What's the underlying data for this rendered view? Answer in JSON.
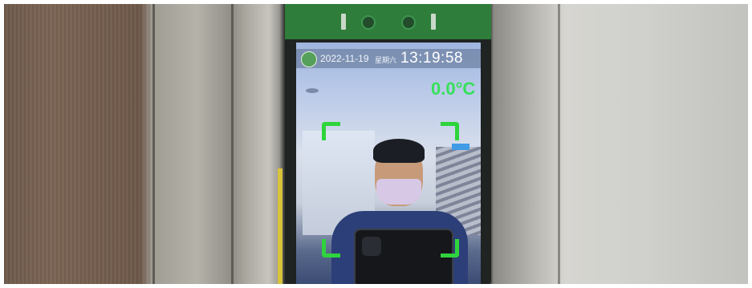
{
  "device_screen": {
    "date": "2022-11-19",
    "weekday": "星期六",
    "time": "13:19:58",
    "temperature": "0.0°C"
  },
  "colors": {
    "frame_green": "#2e7d3a",
    "temperature_green": "#36e05a",
    "face_box_green": "#2fd43d"
  },
  "icons": [
    "logo-icon",
    "camera-icon",
    "sensor-icon"
  ]
}
